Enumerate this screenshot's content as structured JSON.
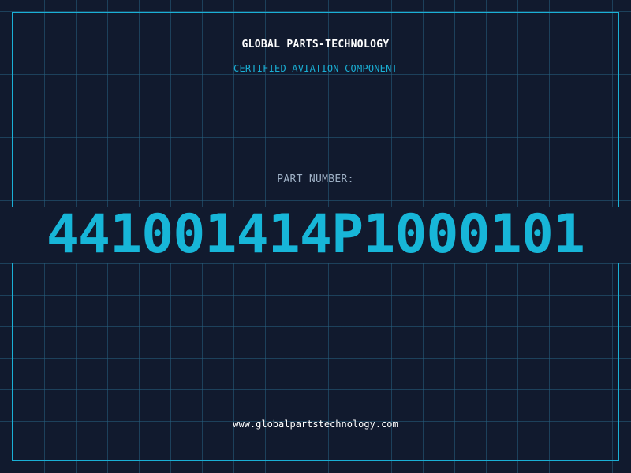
{
  "header": {
    "company": "GLOBAL PARTS-TECHNOLOGY",
    "subtitle": "CERTIFIED AVIATION COMPONENT"
  },
  "part": {
    "label": "PART NUMBER:",
    "number": "441001414P1000101"
  },
  "footer": {
    "url": "www.globalpartstechnology.com"
  },
  "colors": {
    "background": "#111a2e",
    "accent": "#1ab0d6",
    "grid": "#266080",
    "text": "#ffffff"
  }
}
